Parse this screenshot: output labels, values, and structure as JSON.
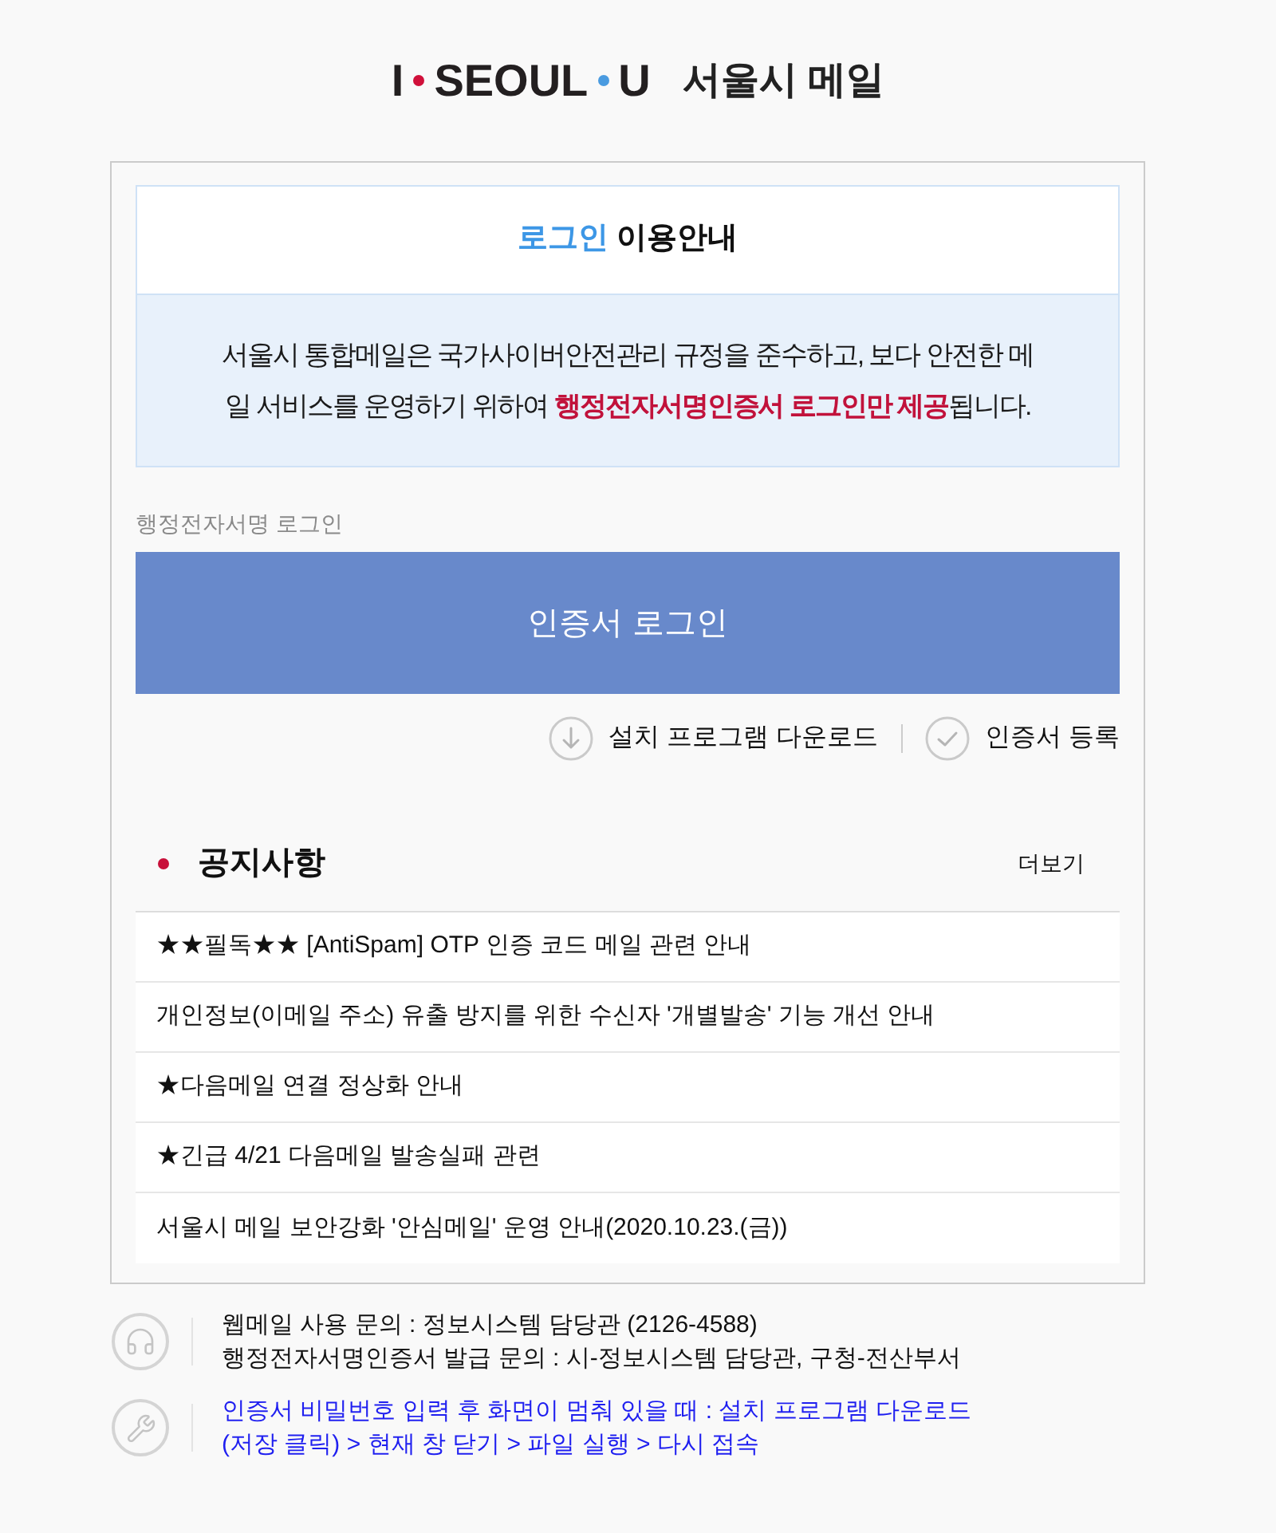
{
  "header": {
    "logo_parts": [
      "I",
      "SEOUL",
      "U"
    ],
    "service_name": "서울시 메일"
  },
  "notice_box": {
    "title": {
      "accent": "로그인",
      "rest": "이용안내"
    },
    "body": "서울시 통합메일은 국가사이버안전관리 규정을 준수하고, 보다 안전한 메일 서비스를 운영하기 위하여 **행정전자서명인증서 로그인만 제공**됩니다."
  },
  "login": {
    "label": "행정전자서명 로그인",
    "button": "인증서 로그인"
  },
  "links": [
    {
      "kind": "download",
      "label": "설치 프로그램 다운로드"
    },
    {
      "kind": "register",
      "label": "인증서 등록"
    }
  ],
  "notices": {
    "title": "공지사항",
    "more": "더보기",
    "items": [
      "★★필독★★ [AntiSpam] OTP 인증 코드 메일 관련 안내",
      "개인정보(이메일 주소) 유출 방지를 위한 수신자 '개별발송' 기능 개선 안내",
      "★다음메일 연결 정상화 안내",
      "★긴급 4/21 다음메일 발송실패 관련",
      "서울시 메일 보안강화 '안심메일' 운영 안내(2020.10.23.(금))"
    ]
  },
  "footer": [
    {
      "kind": "support",
      "lines": [
        "웹메일 사용 문의 : 정보시스템 담당관 (2126-4588)",
        "행정전자서명인증서 발급 문의 : 시-정보시스템 담당관, 구청-전산부서"
      ]
    },
    {
      "kind": "troubleshoot",
      "lines": [
        "인증서 비밀번호 입력 후 화면이 멈춰 있을 때 : 설치 프로그램 다운로드 (저장 클릭) > 현재 창 닫기 > 파일 실행 > 다시 접속"
      ]
    }
  ]
}
